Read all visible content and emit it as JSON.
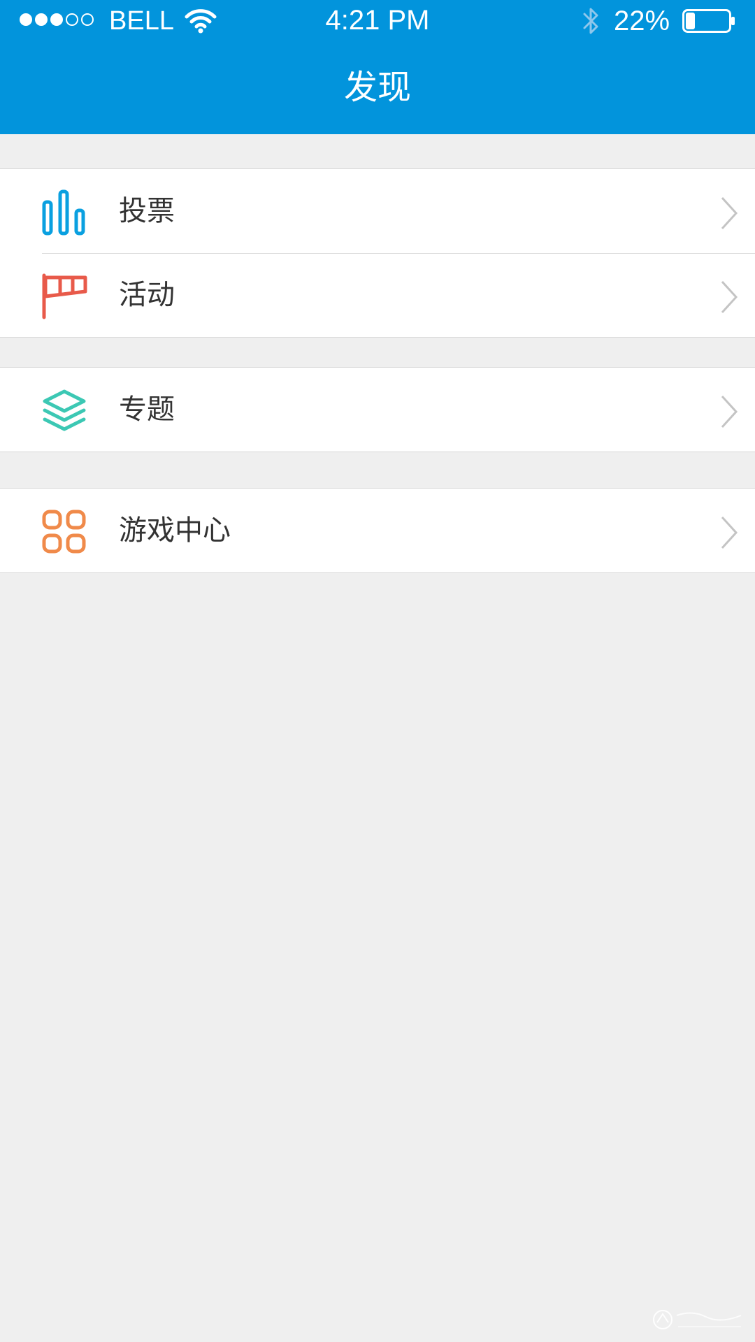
{
  "status_bar": {
    "carrier": "BELL",
    "time": "4:21 PM",
    "battery_percent": "22%",
    "battery_level": 0.22,
    "signal_bars_filled": 3,
    "signal_bars_total": 5
  },
  "header": {
    "title": "发现",
    "background_color": "#0294dc"
  },
  "menu": {
    "groups": [
      {
        "items": [
          {
            "label": "投票",
            "icon": "bar-chart-icon",
            "icon_color": "#0aa0e0"
          },
          {
            "label": "活动",
            "icon": "flag-icon",
            "icon_color": "#e85a4a"
          }
        ]
      },
      {
        "items": [
          {
            "label": "专题",
            "icon": "layers-icon",
            "icon_color": "#3cc8b4"
          }
        ]
      },
      {
        "items": [
          {
            "label": "游戏中心",
            "icon": "grid-icon",
            "icon_color": "#f08a4a"
          }
        ]
      }
    ]
  }
}
